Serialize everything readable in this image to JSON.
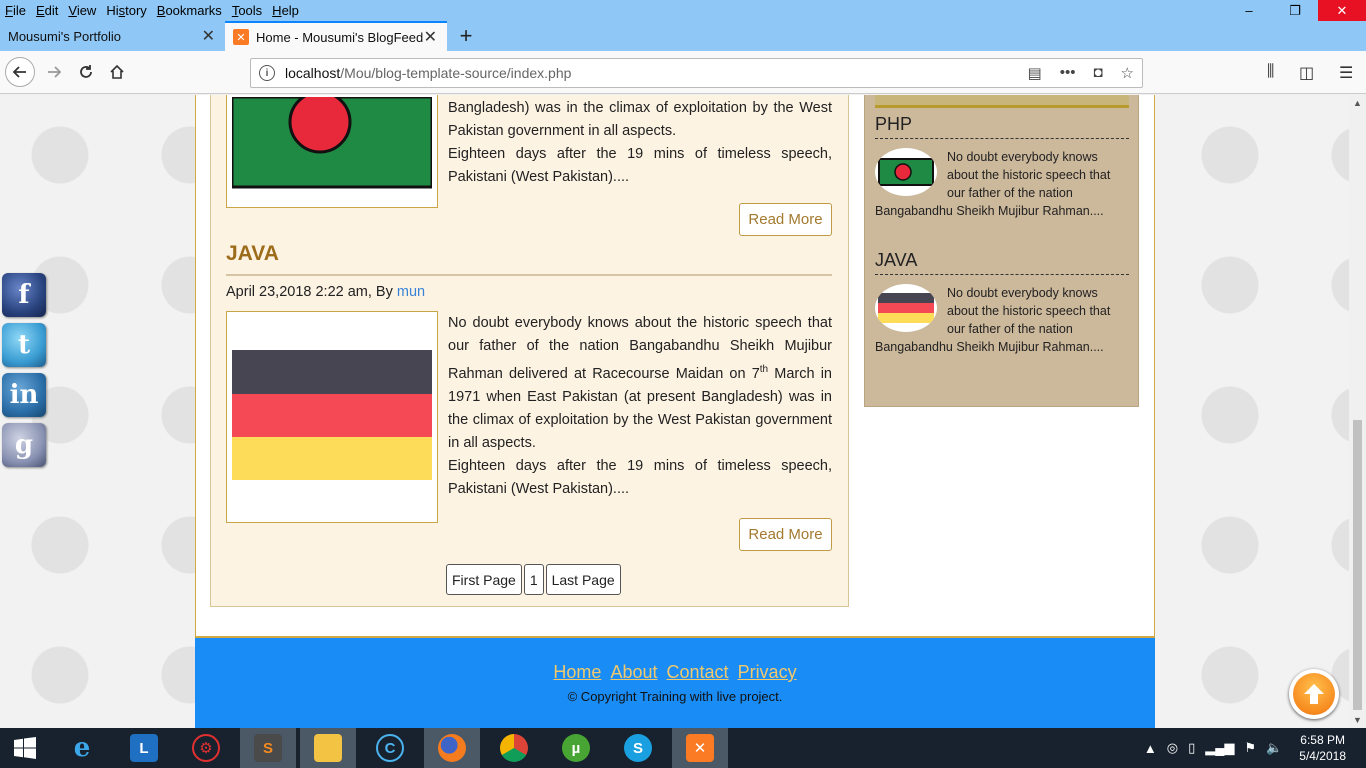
{
  "browser": {
    "menu": [
      "File",
      "Edit",
      "View",
      "History",
      "Bookmarks",
      "Tools",
      "Help"
    ],
    "menu_access_keys": [
      "F",
      "E",
      "V",
      "s",
      "B",
      "T",
      "H"
    ],
    "window_controls": {
      "minimize": "–",
      "maximize": "❐",
      "close": "✕"
    },
    "tabs": [
      {
        "title": "Mousumi's Portfolio",
        "active": false
      },
      {
        "title": "Home - Mousumi's BlogFeed",
        "active": true
      }
    ],
    "new_tab": "+",
    "url_host": "localhost",
    "url_path": "/Mou/blog-template-source/index.php"
  },
  "posts": [
    {
      "title": "",
      "excerpt": [
        "Bangladesh) was in the climax of exploitation by the West Pakistan government in all aspects.",
        "Eighteen days after the 19 mins of timeless speech, Pakistani (West Pakistan)...."
      ],
      "read_more": "Read More",
      "image_icon": "bangladesh-flag-icon"
    },
    {
      "title": "JAVA",
      "date": "April 23,2018 2:22 am, By ",
      "author": "mun",
      "excerpt_intro": "No doubt everybody knows about the historic speech that our father of the nation Bangabandhu Sheikh Mujibur Rahman delivered at Racecourse Maidan on 7",
      "excerpt_sup": "th",
      "excerpt_rest": " March in 1971 when East Pakistan (at present Bangladesh) was in the climax of exploitation by the West Pakistan government in all aspects.",
      "excerpt_2": "Eighteen days after the 19 mins of timeless speech, Pakistani (West Pakistan)....",
      "read_more": "Read More",
      "image_icon": "germany-flag-icon"
    }
  ],
  "pager": {
    "first": "First Page",
    "page": "1",
    "last": "Last Page"
  },
  "sidebar": {
    "items": [
      {
        "title": "PHP",
        "text": "No doubt everybody knows about the historic speech that our father of the nation Bangabandhu Sheikh Mujibur Rahman....",
        "icon": "bangladesh-flag-icon"
      },
      {
        "title": "JAVA",
        "text": "No doubt everybody knows about the historic speech that our father of the nation Bangabandhu Sheikh Mujibur Rahman....",
        "icon": "germany-flag-icon"
      }
    ]
  },
  "social": [
    "f",
    "t",
    "in",
    "g"
  ],
  "footer": {
    "links": [
      "Home",
      "About",
      "Contact",
      "Privacy"
    ],
    "copyright": "© Copyright Training with live project."
  },
  "taskbar": {
    "time": "6:58 PM",
    "date": "5/4/2018"
  },
  "colors": {
    "accent": "#0a84ff",
    "footer_bg": "#1a8cf5",
    "title_brown": "#9c6c1a",
    "main_bg": "#fdf3e3",
    "sidebar_bg": "#ccb89b"
  }
}
